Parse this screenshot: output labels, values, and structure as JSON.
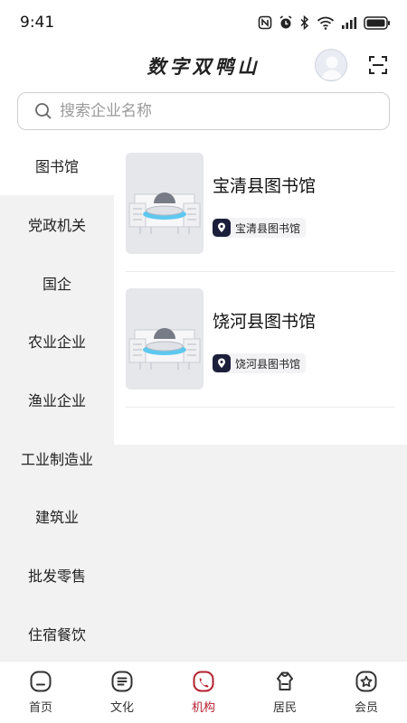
{
  "status_bar": {
    "time": "9:41",
    "icons": [
      "nfc-icon",
      "alarm-icon",
      "bluetooth-icon",
      "wifi-icon",
      "cellular-signal-icon",
      "battery-icon"
    ]
  },
  "header": {
    "title": "数字双鸭山",
    "avatar_icon": "user-avatar-icon",
    "scan_icon": "scan-icon"
  },
  "search": {
    "placeholder": "搜索企业名称",
    "value": ""
  },
  "sidebar": {
    "active_index": 0,
    "items": [
      {
        "label": "图书馆"
      },
      {
        "label": "党政机关"
      },
      {
        "label": "国企"
      },
      {
        "label": "农业企业"
      },
      {
        "label": "渔业企业"
      },
      {
        "label": "工业制造业"
      },
      {
        "label": "建筑业"
      },
      {
        "label": "批发零售"
      },
      {
        "label": "住宿餐饮"
      }
    ]
  },
  "list": {
    "items": [
      {
        "title": "宝清县图书馆",
        "tag": "宝清县图书馆",
        "thumb_icon": "library-building-image",
        "tag_icon": "location-pin-icon"
      },
      {
        "title": "饶河县图书馆",
        "tag": "饶河县图书馆",
        "thumb_icon": "library-building-image",
        "tag_icon": "location-pin-icon"
      }
    ]
  },
  "bottom_nav": {
    "active_index": 2,
    "active_color": "#b3202e",
    "items": [
      {
        "label": "首页",
        "icon": "home-icon"
      },
      {
        "label": "文化",
        "icon": "culture-icon"
      },
      {
        "label": "机构",
        "icon": "institution-icon"
      },
      {
        "label": "居民",
        "icon": "resident-icon"
      },
      {
        "label": "会员",
        "icon": "member-icon"
      }
    ]
  }
}
